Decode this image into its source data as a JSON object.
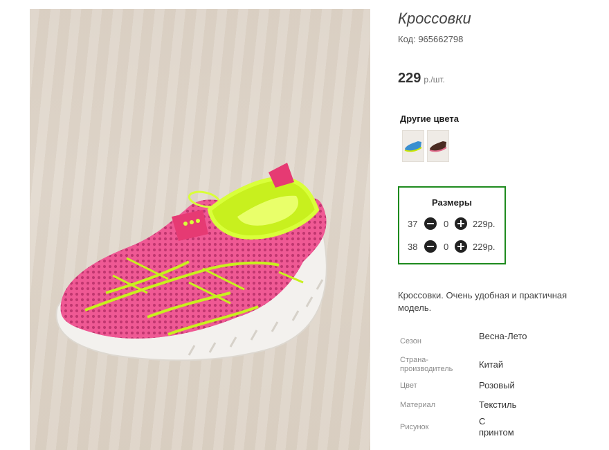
{
  "product": {
    "title": "Кроссовки",
    "code": "Код: 965662798",
    "price_value": "229",
    "price_unit": "р./шт.",
    "image_icon": "sneaker-photo"
  },
  "other_colors": {
    "title": "Другие цвета",
    "swatches": [
      "blue-sneaker-thumbnail",
      "brown-sneaker-thumbnail"
    ]
  },
  "sizes": {
    "title": "Размеры",
    "rows": [
      {
        "size": "37",
        "qty": "0",
        "price": "229р."
      },
      {
        "size": "38",
        "qty": "0",
        "price": "229р."
      }
    ],
    "minus_icon": "minus-circle-icon",
    "plus_icon": "plus-circle-icon",
    "border_color": "#1e8a1e"
  },
  "description": "Кроссовки. Очень удобная и практичная модель.",
  "specs": [
    {
      "label": "Сезон",
      "value": "Весна-Лето"
    },
    {
      "label": "Страна-производитель",
      "value": "Китай"
    },
    {
      "label": "Цвет",
      "value": "Розовый"
    },
    {
      "label": "Материал",
      "value": "Текстиль"
    },
    {
      "label": "Рисунок",
      "value": "С принтом"
    }
  ]
}
